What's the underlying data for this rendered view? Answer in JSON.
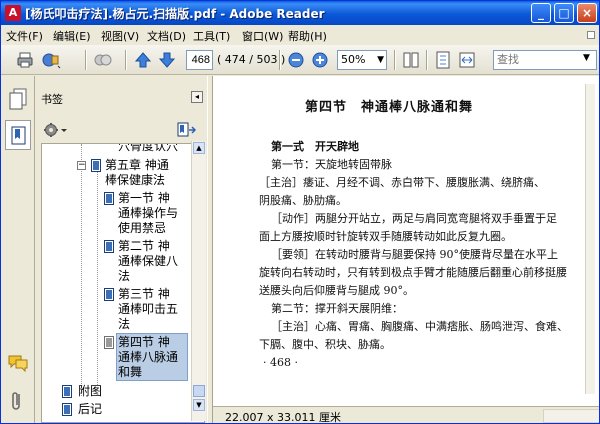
{
  "window": {
    "title": "[杨氏叩击疗法].杨占元.扫描版.pdf - Adobe Reader",
    "controls": {
      "minimize": "_",
      "maximize": "□",
      "close": "×"
    }
  },
  "menu": [
    "文件(F)",
    "编辑(E)",
    "视图(V)",
    "文档(D)",
    "工具(T)",
    "窗口(W)",
    "帮助(H)"
  ],
  "toolbar": {
    "page_input": "468",
    "page_count": "( 474 / 503 )",
    "zoom": "50%",
    "search_placeholder": "查找"
  },
  "bookmarks_panel": {
    "title": "书签",
    "tree": [
      {
        "label": "穴骨度认穴"
      },
      {
        "label": "第五章 神通棒保健康法",
        "lines": [
          "第五章 神通",
          "棒保健康法"
        ],
        "expanded": true
      },
      {
        "lines": [
          "第一节 神",
          "通棒操作与",
          "使用禁忌"
        ]
      },
      {
        "lines": [
          "第二节 神",
          "通棒保健八",
          "法"
        ]
      },
      {
        "lines": [
          "第三节 神",
          "通棒叩击五",
          "法"
        ]
      },
      {
        "lines": [
          "第四节 神",
          "通棒八脉通",
          "和舞"
        ],
        "selected": true
      }
    ],
    "bottom_items": [
      "附图",
      "后记"
    ]
  },
  "document": {
    "heading": "第四节　神通棒八脉通和舞",
    "lines": [
      "第一式　开天辟地",
      "第一节：天旋地转固带脉",
      "［主治］痿证、月经不调、赤白带下、腰腹胀满、绕脐痛、",
      "阴股痛、胁肋痛。",
      "［动作］两腿分开站立，两足与肩同宽弯腿将双手垂置于足",
      "面上方腰按顺时针旋转双手随腰转动如此反复九圈。",
      "［要领］在转动时腰背与腿要保持 90°使腰背尽量在水平上",
      "旋转向右转动时，只有转到极点手臂才能随腰后翻重心前移挺腰",
      "送腰头向后仰腰背与腿成 90°。",
      "第二节：撑开斜天展阴维：",
      "［主治］心痛、胃痛、胸腹痛、中满痞胀、肠鸣泄泻、食难、",
      "下膈、腹中、积块、胁痛。",
      "· 468 ·"
    ]
  },
  "status": {
    "page_size": "22.007 x 33.011 厘米"
  }
}
